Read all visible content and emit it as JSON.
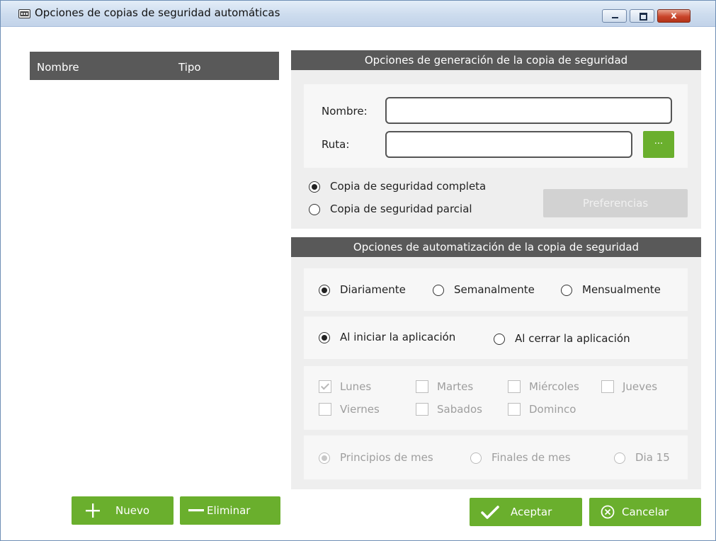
{
  "window": {
    "title": "Opciones de copias de seguridad automáticas",
    "close_glyph": "x"
  },
  "list": {
    "columns": [
      "Nombre",
      "Tipo"
    ]
  },
  "generation": {
    "title": "Opciones de generación de la copia de seguridad",
    "name_label": "Nombre:",
    "name_value": "",
    "path_label": "Ruta:",
    "path_value": "",
    "browse_label": "...",
    "backup_types": [
      {
        "label": "Copia de seguridad completa",
        "selected": true
      },
      {
        "label": "Copia de seguridad parcial",
        "selected": false
      }
    ],
    "preferences_label": "Preferencias"
  },
  "automation": {
    "title": "Opciones de automatización de la copia de seguridad",
    "frequency": [
      {
        "label": "Diariamente",
        "selected": true
      },
      {
        "label": "Semanalmente",
        "selected": false
      },
      {
        "label": "Mensualmente",
        "selected": false
      }
    ],
    "trigger": [
      {
        "label": "Al iniciar la aplicación",
        "selected": true
      },
      {
        "label": "Al cerrar la aplicación",
        "selected": false
      }
    ],
    "days": [
      {
        "label": "Lunes",
        "checked": true
      },
      {
        "label": "Martes",
        "checked": false
      },
      {
        "label": "Miércoles",
        "checked": false
      },
      {
        "label": "Jueves",
        "checked": false
      },
      {
        "label": "Viernes",
        "checked": false
      },
      {
        "label": "Sabados",
        "checked": false
      },
      {
        "label": "Dominco",
        "checked": false
      }
    ],
    "month_options": [
      {
        "label": "Principios de mes",
        "selected": true
      },
      {
        "label": "Finales de mes",
        "selected": false
      },
      {
        "label": "Dia 15",
        "selected": false
      }
    ]
  },
  "buttons": {
    "new_label": "Nuevo",
    "delete_label": "Eliminar",
    "accept_label": "Aceptar",
    "cancel_label": "Cancelar"
  },
  "colors": {
    "accent_green": "#6aaf2d",
    "header_gray": "#595959"
  }
}
